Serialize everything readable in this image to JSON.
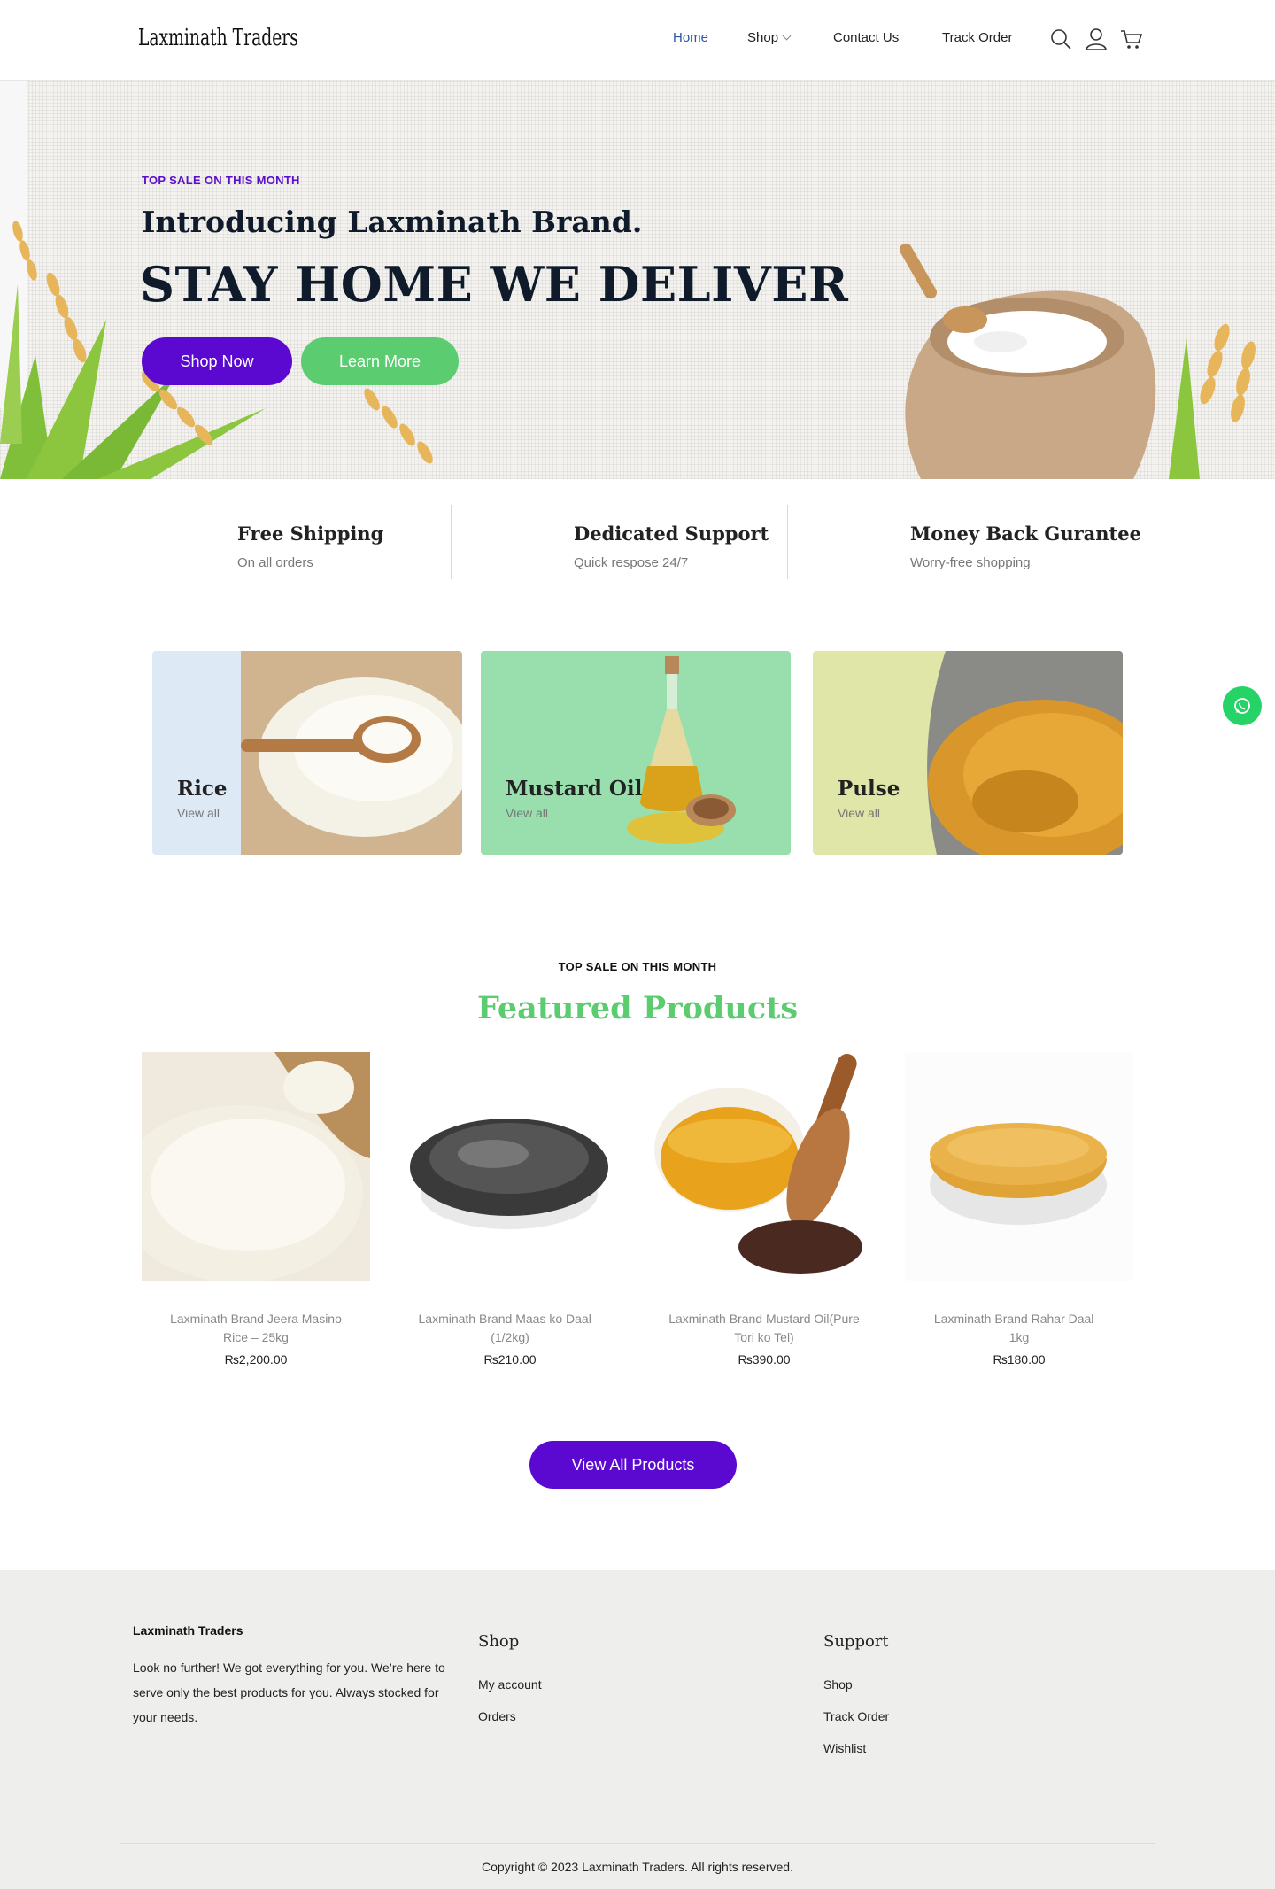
{
  "header": {
    "logo": "Laxminath Traders",
    "nav": {
      "home": "Home",
      "shop": "Shop",
      "contact": "Contact Us",
      "track": "Track Order"
    },
    "icons": [
      "search-icon",
      "user-icon",
      "cart-icon"
    ],
    "active_color": "#2a55a8"
  },
  "hero": {
    "tag": "TOP SALE ON THIS MONTH",
    "subtitle": "Introducing Laxminath Brand.",
    "title": "STAY HOME WE DELIVER",
    "shop_button": "Shop Now",
    "learn_button": "Learn More"
  },
  "features": [
    {
      "title": "Free Shipping",
      "sub": "On all orders"
    },
    {
      "title": "Dedicated Support",
      "sub": "Quick respose 24/7"
    },
    {
      "title": "Money Back Gurantee",
      "sub": "Worry-free shopping"
    }
  ],
  "categories": [
    {
      "name": "Rice",
      "link": "View all",
      "bg": "#dde9f5"
    },
    {
      "name": "Mustard Oil",
      "link": "View all",
      "bg": "#98dfad"
    },
    {
      "name": "Pulse",
      "link": "View all",
      "bg": "#dfe6a8"
    }
  ],
  "featured": {
    "tag": "TOP SALE ON THIS MONTH",
    "title": "Featured Products",
    "products": [
      {
        "name": "Laxminath Brand Jeera Masino Rice – 25kg",
        "price": "₨2,200.00"
      },
      {
        "name": "Laxminath Brand Maas ko Daal – (1/2kg)",
        "price": "₨210.00"
      },
      {
        "name": "Laxminath Brand Mustard Oil(Pure Tori ko Tel)",
        "price": "₨390.00"
      },
      {
        "name": "Laxminath Brand Rahar Daal – 1kg",
        "price": "₨180.00"
      }
    ],
    "view_all": "View All Products"
  },
  "footer": {
    "brand": "Laxminath Traders",
    "desc": "Look no further! We got everything for you. We’re here to serve only the best products for you. Always stocked for your needs.",
    "shop": {
      "heading": "Shop",
      "links": [
        "My account",
        "Orders"
      ]
    },
    "support": {
      "heading": "Support",
      "links": [
        "Shop",
        "Track Order",
        "Wishlist"
      ]
    },
    "copyright": "Copyright © 2023 Laxminath Traders. All rights reserved."
  },
  "colors": {
    "primary": "#5b09d1",
    "green": "#5ccc71",
    "whatsapp": "#25d366"
  }
}
